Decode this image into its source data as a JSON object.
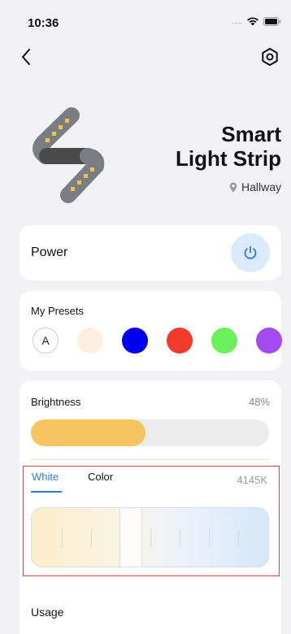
{
  "status": {
    "time": "10:36",
    "signal": "....."
  },
  "device": {
    "title_line1": "Smart",
    "title_line2": "Light Strip",
    "location": "Hallway"
  },
  "power": {
    "label": "Power",
    "state": "on"
  },
  "presets": {
    "title": "My Presets",
    "auto_label": "A",
    "swatches": [
      "#fbefe0",
      "#0000ee",
      "#ef3a2c",
      "#6af05a",
      "#a34af2"
    ]
  },
  "brightness": {
    "label": "Brightness",
    "value_text": "48%",
    "value": 0.48
  },
  "white_panel": {
    "tab_white": "White",
    "tab_color": "Color",
    "active_tab": "White",
    "kelvin_text": "4145K"
  },
  "usage": {
    "label": "Usage"
  },
  "colors": {
    "accent": "#2f7bd8",
    "brightness_fill": "#f5c55f",
    "power_button_bg": "#dbe9fb"
  }
}
